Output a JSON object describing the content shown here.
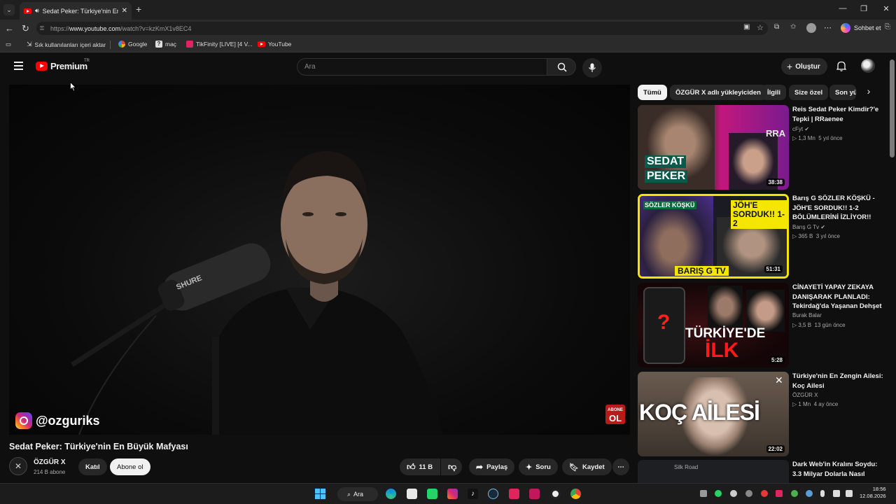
{
  "browser": {
    "tab_title": "Sedat Peker: Türkiye'nin En B...",
    "url_prefix": "https://",
    "url_host": "www.youtube.com",
    "url_path": "/watch?v=kzKmX1v8EC4",
    "copilot_label": "Sohbet et",
    "bookmarks": [
      {
        "label": "Sık kullanılanları içeri aktar"
      },
      {
        "label": "Google"
      },
      {
        "label": "maç"
      },
      {
        "label": "TikFinity [LIVE] [4 V..."
      },
      {
        "label": "YouTube"
      }
    ]
  },
  "header": {
    "logo_text": "Premium",
    "logo_sup": "TR",
    "search_placeholder": "Ara",
    "create_label": "Oluştur"
  },
  "player": {
    "handle": "@ozguriks",
    "sub_badge_line1": "ABONE",
    "sub_badge_line2": "OL",
    "mic_brand": "SHURE"
  },
  "video": {
    "title": "Sedat Peker: Türkiye'nin En Büyük Mafyası",
    "channel": "ÖZGÜR X",
    "subscribers": "214 B abone",
    "join_label": "Katıl",
    "subscribe_label": "Abone ol",
    "likes": "11 B",
    "share_label": "Paylaş",
    "ask_label": "Soru",
    "save_label": "Kaydet"
  },
  "chips": [
    "Tümü",
    "ÖZGÜR X adlı yükleyiciden",
    "İlgili",
    "Size özel",
    "Son yü"
  ],
  "recommendations": [
    {
      "title": "Reis Sedat Peker Kimdir?'e Tepki | RRaenee",
      "channel": "cFyt",
      "views": "1,3 Mn",
      "age": "5 yıl önce",
      "duration": "38:38",
      "thumb_text1": "SEDAT",
      "thumb_text2": "PEKER",
      "thumb_corner": "RRA"
    },
    {
      "title": "Barış G SÖZLER KÖŞKÜ - JÖH'E SORDUK!! 1-2 BÖLÜMLERİNİ İZLİYOR!!",
      "channel": "Barış G Tv",
      "views": "365 B",
      "age": "3 yıl önce",
      "duration": "51:31",
      "thumb_text1": "SÖZLER KÖŞKÜ",
      "thumb_text2": "JÖH'E SORDUK!! 1-2",
      "thumb_text3": "BARIŞ G TV"
    },
    {
      "title": "CİNAYETİ YAPAY ZEKAYA DANIŞARAK PLANLADI: Tekirdağ'da Yaşanan Dehşet",
      "channel": "Burak Balar",
      "views": "3,5 B",
      "age": "13 gün önce",
      "duration": "5:28",
      "thumb_text1": "TÜRKİYE'DE",
      "thumb_text2": "İLK"
    },
    {
      "title": "Türkiye'nin En Zengin Ailesi: Koç Ailesi",
      "channel": "ÖZGÜR X",
      "views": "1 Mn",
      "age": "4 ay önce",
      "duration": "22:02",
      "thumb_text1": "KOÇ AİLESİ"
    },
    {
      "title": "Dark Web'in Kralını Soydu: 3.3 Milyar Dolarla Nasıl",
      "thumb_text1": "Silk Road"
    }
  ],
  "taskbar": {
    "search_label": "Ara",
    "time": "18:56",
    "date": "12.08.2026"
  },
  "colors": {
    "brand_red": "#ff0000",
    "background": "#0f0f0f",
    "chip_active_bg": "#f1f1f1"
  }
}
